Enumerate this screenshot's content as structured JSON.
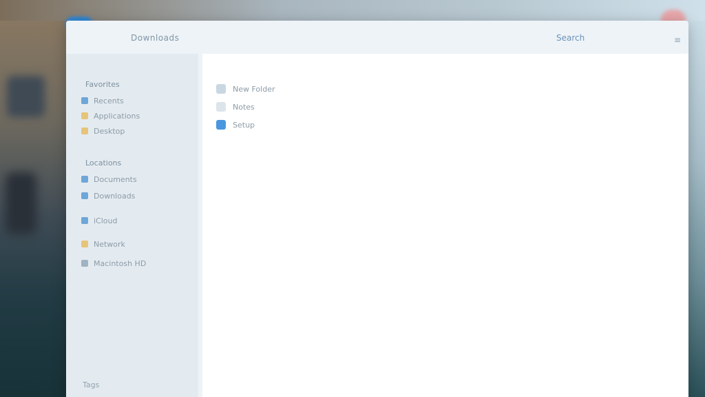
{
  "window": {
    "title": "Downloads",
    "top_right_label": "Search",
    "menu_symbol": "≡"
  },
  "sidebar": {
    "favorites_label": "Favorites",
    "favorites": [
      {
        "label": "Recents",
        "icon": "clock-icon"
      },
      {
        "label": "Applications",
        "icon": "folder-icon"
      },
      {
        "label": "Desktop",
        "icon": "folder-icon"
      }
    ],
    "locations_label": "Locations",
    "locations": [
      {
        "label": "Documents",
        "icon": "folder-icon"
      },
      {
        "label": "Downloads",
        "icon": "folder-icon"
      },
      {
        "label": "iCloud",
        "icon": "cloud-icon"
      },
      {
        "label": "Network",
        "icon": "folder-icon"
      },
      {
        "label": "Macintosh HD",
        "icon": "drive-icon"
      }
    ],
    "footer_label": "Tags"
  },
  "main": {
    "files": [
      {
        "name": "New Folder",
        "icon": "folder-icon"
      },
      {
        "name": "Notes",
        "icon": "document-icon"
      },
      {
        "name": "Setup",
        "icon": "blue-circle-icon"
      }
    ]
  },
  "colors": {
    "accent": "#2f86d6",
    "window_bg": "#eef3f7",
    "sidebar_bg": "#e4ebf0",
    "content_bg": "#ffffff"
  }
}
